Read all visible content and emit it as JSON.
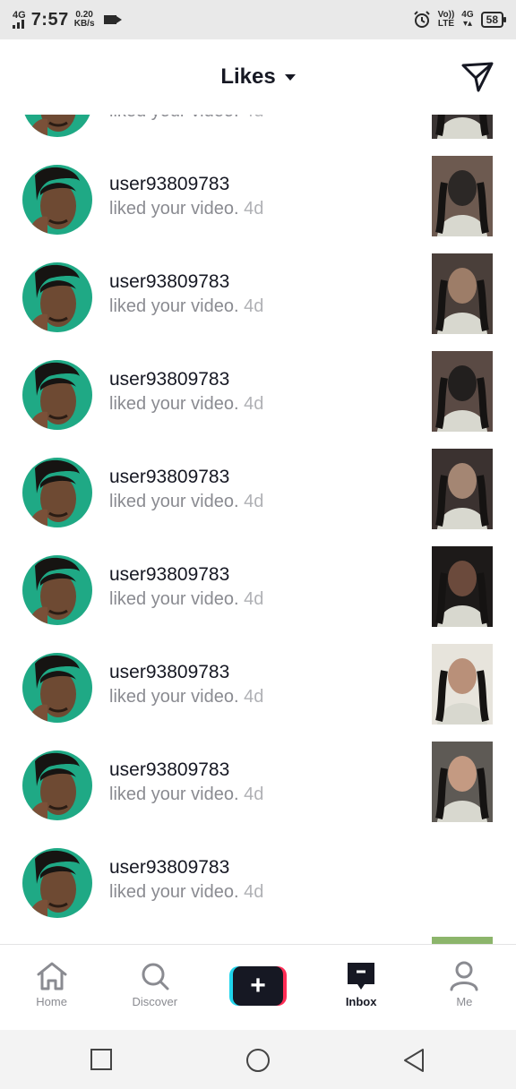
{
  "status_bar": {
    "network": "4G",
    "time": "7:57",
    "speed_value": "0.20",
    "speed_unit": "KB/s",
    "volte_top": "Vo))",
    "volte_bottom": "LTE",
    "net2_top": "4G",
    "battery": "58"
  },
  "header": {
    "title": "Likes"
  },
  "notifications": [
    {
      "username": "user93809783",
      "message": "liked your video.",
      "ago": "4d"
    },
    {
      "username": "user93809783",
      "message": "liked your video.",
      "ago": "4d"
    },
    {
      "username": "user93809783",
      "message": "liked your video.",
      "ago": "4d"
    },
    {
      "username": "user93809783",
      "message": "liked your video.",
      "ago": "4d"
    },
    {
      "username": "user93809783",
      "message": "liked your video.",
      "ago": "4d"
    },
    {
      "username": "user93809783",
      "message": "liked your video.",
      "ago": "4d"
    },
    {
      "username": "user93809783",
      "message": "liked your video.",
      "ago": "4d"
    },
    {
      "username": "user93809783",
      "message": "liked your video.",
      "ago": "4d"
    },
    {
      "username": "user93809783",
      "message": "liked your video.",
      "ago": "4d"
    },
    {
      "username": "",
      "message": "",
      "ago": ""
    }
  ],
  "tabs": [
    {
      "label": "Home",
      "icon": "home-icon"
    },
    {
      "label": "Discover",
      "icon": "search-icon"
    },
    {
      "label": "",
      "icon": "plus-icon"
    },
    {
      "label": "Inbox",
      "icon": "inbox-icon"
    },
    {
      "label": "Me",
      "icon": "person-icon"
    }
  ],
  "colors": {
    "accent_pink": "#fe2c55",
    "accent_cyan": "#20d5ec",
    "text_primary": "#161823",
    "text_secondary": "#8a8b91",
    "avatar_bg": "#1fa985"
  }
}
